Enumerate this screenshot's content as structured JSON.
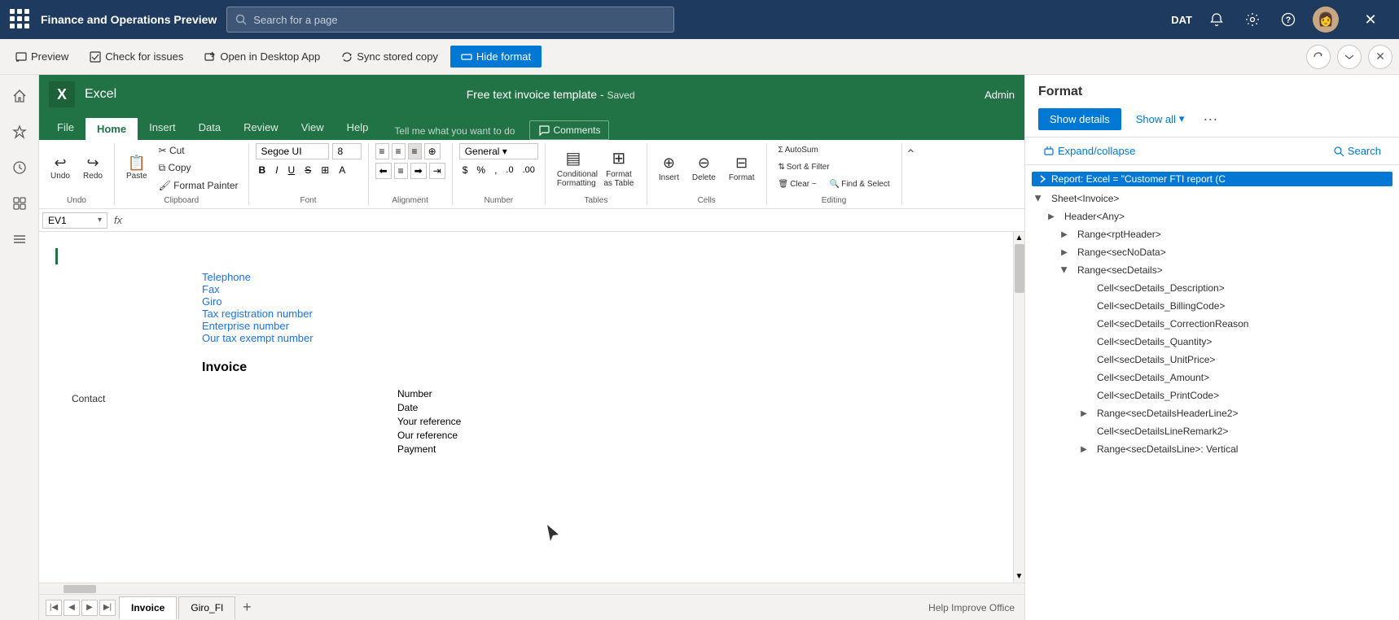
{
  "topNav": {
    "appTitle": "Finance and Operations Preview",
    "searchPlaceholder": "Search for a page",
    "envLabel": "DAT"
  },
  "toolbar2": {
    "previewLabel": "Preview",
    "checkIssuesLabel": "Check for issues",
    "openDesktopLabel": "Open in Desktop App",
    "syncLabel": "Sync stored copy",
    "hideFormatLabel": "Hide format"
  },
  "excel": {
    "logoText": "X",
    "appName": "Excel",
    "docTitle": "Free text invoice template",
    "docStatus": "Saved",
    "adminLabel": "Admin",
    "ribbonTabs": [
      "File",
      "Home",
      "Insert",
      "Data",
      "Review",
      "View",
      "Help"
    ],
    "activeTab": "Home",
    "tellPlaceholder": "Tell me what you want to do",
    "commentsLabel": "Comments",
    "formulaCell": "EV1",
    "formulaValue": "",
    "groups": {
      "undo": "Undo",
      "clipboard": "Clipboard",
      "font": "Font",
      "alignment": "Alignment",
      "number": "Number",
      "tables": "Tables",
      "cells": "Cells",
      "editing": "Editing"
    },
    "fontName": "Segoe UI",
    "fontSize": "8",
    "formatAsTableLabel": "Format as Table",
    "clearLabel": "Clear ~",
    "sortFilterLabel": "Sort & Filter",
    "findSelectLabel": "Find & Select",
    "autoSumLabel": "AutoSum",
    "conditionalFormattingLabel": "Conditional Formatting",
    "insertLabel": "Insert",
    "deleteLabel": "Delete",
    "formatLabel": "Format"
  },
  "invoiceContent": {
    "fields": [
      "Telephone",
      "Fax",
      "Giro",
      "Tax registration number",
      "Enterprise number",
      "Our tax exempt number"
    ],
    "title": "Invoice",
    "labels": [
      "Number",
      "Date",
      "Your reference",
      "Our reference",
      "Payment",
      "Contact"
    ]
  },
  "sheetTabs": [
    {
      "label": "Invoice",
      "active": true
    },
    {
      "label": "Giro_FI",
      "active": false
    }
  ],
  "rightPanel": {
    "title": "Format",
    "showDetailsLabel": "Show details",
    "showAllLabel": "Show all",
    "expandCollapseLabel": "Expand/collapse",
    "searchLabel": "Search",
    "treeItems": [
      {
        "label": "Report: Excel = \"Customer FTI report (C",
        "level": 0,
        "expanded": true,
        "isRoot": true
      },
      {
        "label": "Sheet<Invoice>",
        "level": 1,
        "expanded": true
      },
      {
        "label": "Header<Any>",
        "level": 2,
        "expanded": false
      },
      {
        "label": "Range<rptHeader>",
        "level": 3,
        "expanded": false
      },
      {
        "label": "Range<secNoData>",
        "level": 3,
        "expanded": false
      },
      {
        "label": "Range<secDetails>",
        "level": 3,
        "expanded": true
      },
      {
        "label": "Cell<secDetails_Description>",
        "level": 4,
        "expanded": false
      },
      {
        "label": "Cell<secDetails_BillingCode>",
        "level": 4,
        "expanded": false
      },
      {
        "label": "Cell<secDetails_CorrectionReason",
        "level": 4,
        "expanded": false
      },
      {
        "label": "Cell<secDetails_Quantity>",
        "level": 4,
        "expanded": false
      },
      {
        "label": "Cell<secDetails_UnitPrice>",
        "level": 4,
        "expanded": false
      },
      {
        "label": "Cell<secDetails_Amount>",
        "level": 4,
        "expanded": false
      },
      {
        "label": "Cell<secDetails_PrintCode>",
        "level": 4,
        "expanded": false
      },
      {
        "label": "Range<secDetailsHeaderLine2>",
        "level": 4,
        "expanded": false
      },
      {
        "label": "Cell<secDetailsLineRemark2>",
        "level": 4,
        "expanded": false
      },
      {
        "label": "Range<secDetailsLine>: Vertical",
        "level": 4,
        "expanded": false
      }
    ]
  },
  "statusBar": {
    "helpLabel": "Help Improve Office"
  }
}
